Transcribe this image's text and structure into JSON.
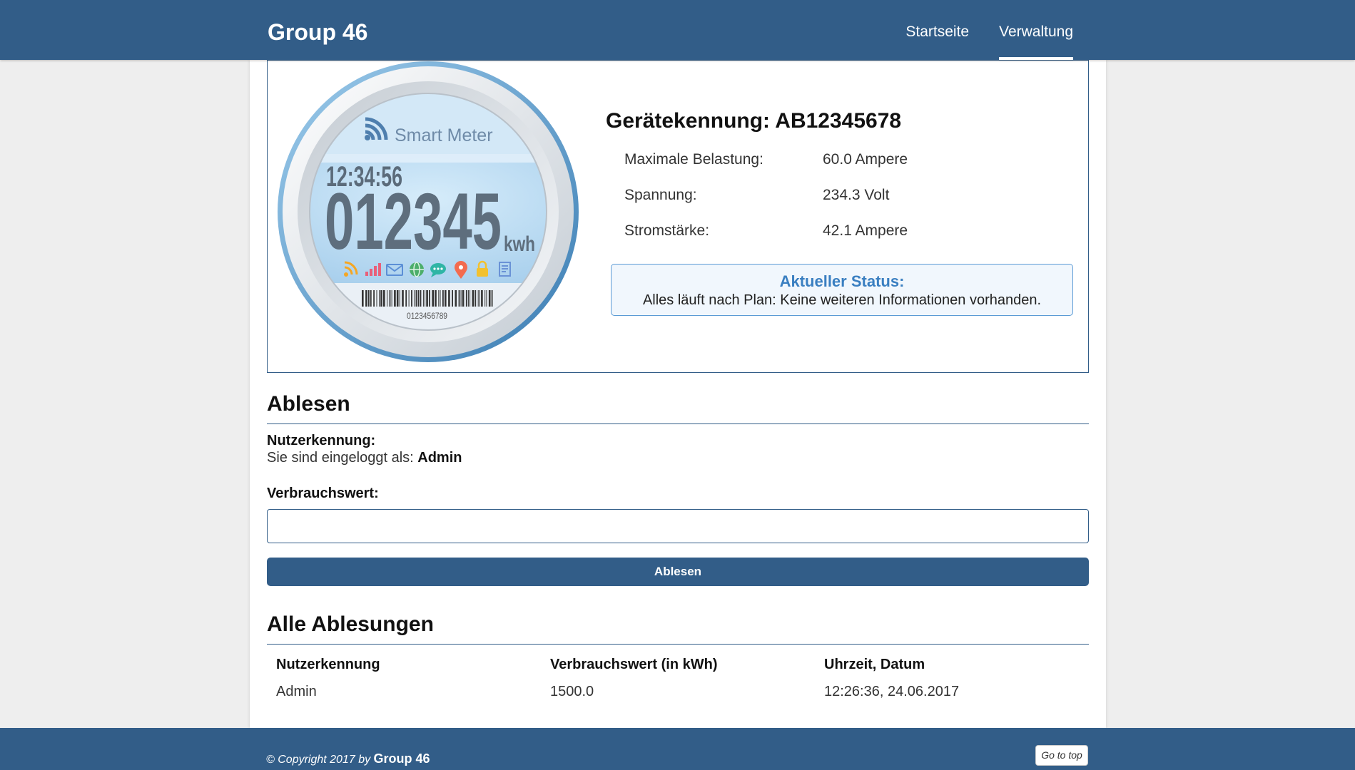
{
  "theme": {
    "primary": "#325d88",
    "status_border": "#5b9bd5",
    "status_background": "#f1f7fd",
    "status_title": "#3a7fc1"
  },
  "header": {
    "brand": "Group 46",
    "nav": [
      {
        "label": "Startseite",
        "active": false
      },
      {
        "label": "Verwaltung",
        "active": true
      }
    ]
  },
  "device": {
    "meter": {
      "brand_label": "Smart Meter",
      "time": "12:34:56",
      "reading": "012345",
      "unit": "kwh",
      "barcode_number": "0123456789",
      "icons": [
        "wifi-icon",
        "rss-icon",
        "signal-icon",
        "mail-icon",
        "globe-icon",
        "chat-icon",
        "location-icon",
        "lock-icon",
        "document-icon"
      ]
    },
    "id_label": "Gerätekennung:",
    "id_value": "AB12345678",
    "specs": [
      {
        "label": "Maximale Belastung:",
        "value": "60.0 Ampere"
      },
      {
        "label": "Spannung:",
        "value": "234.3 Volt"
      },
      {
        "label": "Stromstärke:",
        "value": "42.1 Ampere"
      }
    ],
    "status": {
      "title": "Aktueller Status:",
      "text": "Alles läuft nach Plan: Keine weiteren Informationen vorhanden."
    }
  },
  "reading_form": {
    "heading": "Ablesen",
    "user_label": "Nutzerkennung:",
    "logged_in_prefix": "Sie sind eingeloggt als:",
    "logged_in_user": "Admin",
    "value_label": "Verbrauchswert:",
    "value_input": "",
    "submit_label": "Ablesen"
  },
  "readings": {
    "heading": "Alle Ablesungen",
    "columns": [
      "Nutzerkennung",
      "Verbrauchswert (in kWh)",
      "Uhrzeit, Datum"
    ],
    "rows": [
      [
        "Admin",
        "1500.0",
        "12:26:36, 24.06.2017"
      ]
    ]
  },
  "footer": {
    "copyright_prefix": "© Copyright 2017 by",
    "brand": "Group 46",
    "go_top_label": "Go to top"
  }
}
